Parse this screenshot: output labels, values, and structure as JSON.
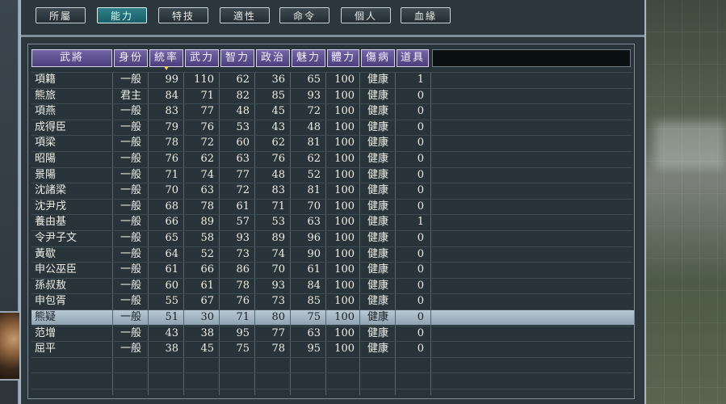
{
  "tabs": [
    {
      "label": "所屬",
      "active": false
    },
    {
      "label": "能力",
      "active": true
    },
    {
      "label": "特技",
      "active": false
    },
    {
      "label": "適性",
      "active": false
    },
    {
      "label": "命令",
      "active": false
    },
    {
      "label": "個人",
      "active": false
    },
    {
      "label": "血緣",
      "active": false
    }
  ],
  "columns": [
    "武將",
    "身份",
    "統率",
    "武力",
    "智力",
    "政治",
    "魅力",
    "體力",
    "傷病",
    "道具"
  ],
  "sorted_column": "統率",
  "selected_row_index": 15,
  "rows": [
    [
      "項籍",
      "一般",
      "99",
      "110",
      "62",
      "36",
      "65",
      "100",
      "健康",
      "1"
    ],
    [
      "熊旅",
      "君主",
      "84",
      "71",
      "82",
      "85",
      "93",
      "100",
      "健康",
      "0"
    ],
    [
      "項燕",
      "一般",
      "83",
      "77",
      "48",
      "45",
      "72",
      "100",
      "健康",
      "0"
    ],
    [
      "成得臣",
      "一般",
      "79",
      "76",
      "53",
      "43",
      "48",
      "100",
      "健康",
      "0"
    ],
    [
      "項梁",
      "一般",
      "78",
      "72",
      "60",
      "62",
      "81",
      "100",
      "健康",
      "0"
    ],
    [
      "昭陽",
      "一般",
      "76",
      "62",
      "63",
      "76",
      "62",
      "100",
      "健康",
      "0"
    ],
    [
      "景陽",
      "一般",
      "71",
      "74",
      "77",
      "48",
      "52",
      "100",
      "健康",
      "0"
    ],
    [
      "沈諸梁",
      "一般",
      "70",
      "63",
      "72",
      "83",
      "81",
      "100",
      "健康",
      "0"
    ],
    [
      "沈尹戌",
      "一般",
      "68",
      "78",
      "61",
      "71",
      "70",
      "100",
      "健康",
      "0"
    ],
    [
      "養由基",
      "一般",
      "66",
      "89",
      "57",
      "53",
      "63",
      "100",
      "健康",
      "1"
    ],
    [
      "令尹子文",
      "一般",
      "65",
      "58",
      "93",
      "89",
      "96",
      "100",
      "健康",
      "0"
    ],
    [
      "黃歇",
      "一般",
      "64",
      "52",
      "73",
      "74",
      "90",
      "100",
      "健康",
      "0"
    ],
    [
      "申公巫臣",
      "一般",
      "61",
      "66",
      "86",
      "70",
      "61",
      "100",
      "健康",
      "0"
    ],
    [
      "孫叔敖",
      "一般",
      "60",
      "61",
      "78",
      "93",
      "84",
      "100",
      "健康",
      "0"
    ],
    [
      "申包胥",
      "一般",
      "55",
      "67",
      "76",
      "73",
      "85",
      "100",
      "健康",
      "0"
    ],
    [
      "熊疑",
      "一般",
      "51",
      "30",
      "71",
      "80",
      "75",
      "100",
      "健康",
      "0"
    ],
    [
      "范增",
      "一般",
      "43",
      "38",
      "95",
      "77",
      "63",
      "100",
      "健康",
      "0"
    ],
    [
      "屈平",
      "一般",
      "38",
      "45",
      "75",
      "78",
      "95",
      "100",
      "健康",
      "0"
    ]
  ]
}
